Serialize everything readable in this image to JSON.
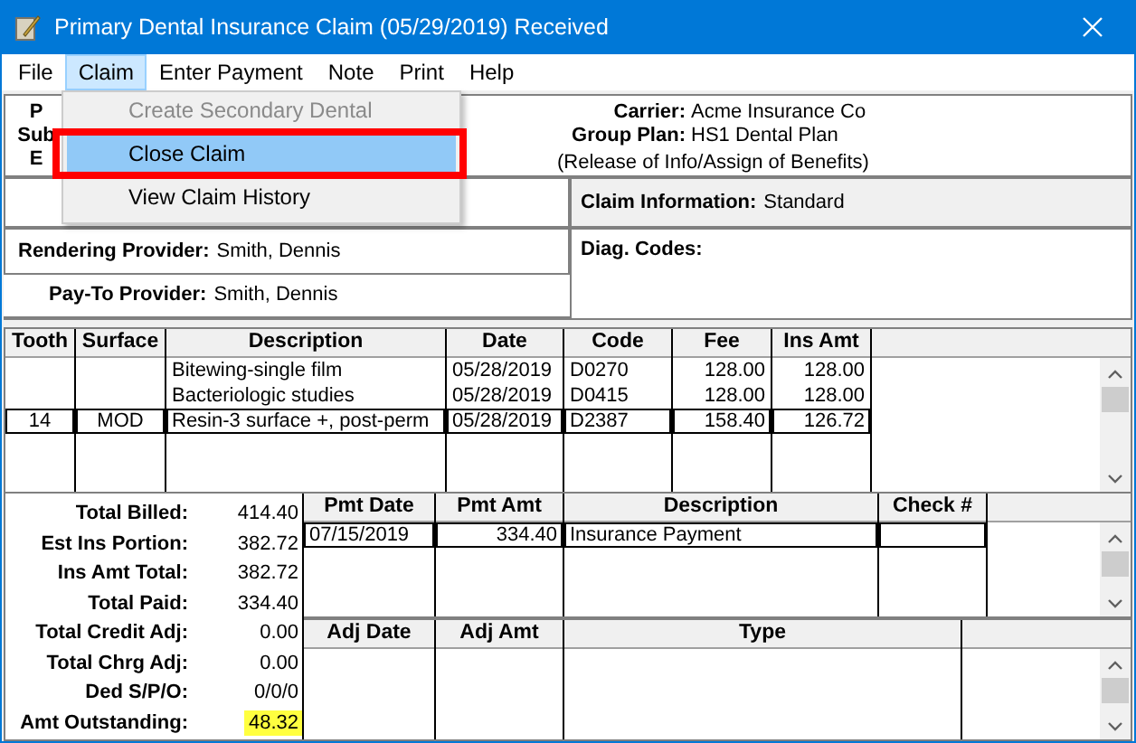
{
  "window": {
    "title": "Primary Dental Insurance Claim (05/29/2019) Received"
  },
  "menu_bar": [
    {
      "label": "File",
      "selected": false
    },
    {
      "label": "Claim",
      "selected": true
    },
    {
      "label": "Enter Payment",
      "selected": false
    },
    {
      "label": "Note",
      "selected": false
    },
    {
      "label": "Print",
      "selected": false
    },
    {
      "label": "Help",
      "selected": false
    }
  ],
  "claim_menu": [
    {
      "label": "Create Secondary Dental",
      "disabled": true,
      "selected": false
    },
    {
      "label": "Close Claim",
      "disabled": false,
      "selected": true
    },
    {
      "label": "View Claim History",
      "disabled": false,
      "selected": false
    }
  ],
  "header": {
    "left_labels": [
      "P",
      "Sub",
      "E"
    ],
    "fields": [
      {
        "label": "Carrier:",
        "value": "Acme Insurance Co"
      },
      {
        "label": "Group Plan:",
        "value": "HS1 Dental Plan"
      }
    ],
    "note": "(Release of Info/Assign of Benefits)"
  },
  "claim_information": {
    "label": "Claim Information:",
    "value": "Standard"
  },
  "rendering_provider": {
    "label": "Rendering Provider:",
    "value": "Smith, Dennis"
  },
  "pay_to_provider": {
    "label": "Pay-To Provider:",
    "value": "Smith, Dennis"
  },
  "diag_codes": {
    "label": "Diag. Codes:"
  },
  "procedures": {
    "columns": [
      "Tooth",
      "Surface",
      "Description",
      "Date",
      "Code",
      "Fee",
      "Ins Amt"
    ],
    "rows": [
      {
        "cells": [
          "",
          "",
          "Bitewing-single film",
          "05/28/2019",
          "D0270",
          "128.00",
          "128.00"
        ],
        "selected": false
      },
      {
        "cells": [
          "",
          "",
          "Bacteriologic studies",
          "05/28/2019",
          "D0415",
          "128.00",
          "128.00"
        ],
        "selected": false
      },
      {
        "cells": [
          "14",
          "MOD",
          "Resin-3 surface +, post-perm",
          "05/28/2019",
          "D2387",
          "158.40",
          "126.72"
        ],
        "selected": true
      }
    ]
  },
  "summary": [
    {
      "label": "Total Billed:",
      "value": "414.40",
      "highlighted": false
    },
    {
      "label": "Est Ins Portion:",
      "value": "382.72",
      "highlighted": false
    },
    {
      "label": "Ins Amt Total:",
      "value": "382.72",
      "highlighted": false
    },
    {
      "label": "Total Paid:",
      "value": "334.40",
      "highlighted": false
    },
    {
      "label": "Total Credit Adj:",
      "value": "0.00",
      "highlighted": false
    },
    {
      "label": "Total Chrg Adj:",
      "value": "0.00",
      "highlighted": false
    },
    {
      "label": "Ded S/P/O:",
      "value": "0/0/0",
      "highlighted": false
    },
    {
      "label": "Amt Outstanding:",
      "value": "48.32",
      "highlighted": true
    }
  ],
  "payments": {
    "columns": [
      "Pmt Date",
      "Pmt Amt",
      "Description",
      "Check #"
    ],
    "rows": [
      {
        "cells": [
          "07/15/2019",
          "334.40",
          "Insurance Payment",
          ""
        ],
        "selected": true
      }
    ]
  },
  "adjustments": {
    "columns": [
      "Adj Date",
      "Adj Amt",
      "Type"
    ]
  }
}
